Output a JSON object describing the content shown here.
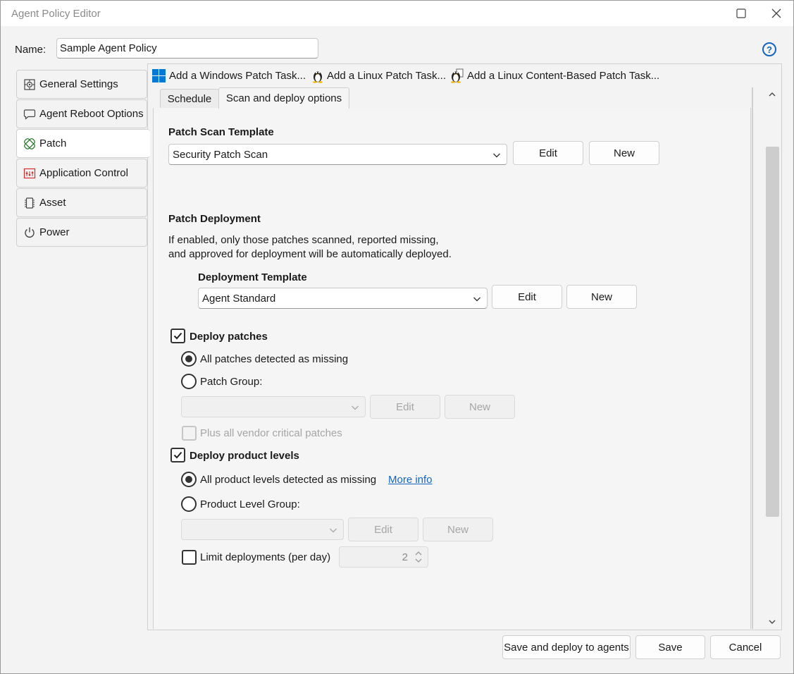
{
  "window": {
    "title": "Agent Policy Editor"
  },
  "name": {
    "label": "Name:",
    "value": "Sample Agent Policy"
  },
  "sidebar": {
    "items": [
      {
        "label": "General Settings",
        "icon": "gear-icon"
      },
      {
        "label": "Agent Reboot Options",
        "icon": "speech-bubble-icon"
      },
      {
        "label": "Patch",
        "icon": "patch-icon"
      },
      {
        "label": "Application Control",
        "icon": "application-control-icon"
      },
      {
        "label": "Asset",
        "icon": "chip-icon"
      },
      {
        "label": "Power",
        "icon": "power-icon"
      }
    ],
    "active_index": 2
  },
  "toolbar": {
    "windows_task": "Add a Windows Patch Task...",
    "linux_task": "Add a Linux Patch Task...",
    "linux_content_task": "Add a Linux Content-Based Patch Task..."
  },
  "tabs": [
    {
      "label": "Schedule"
    },
    {
      "label": "Scan and deploy options"
    }
  ],
  "scan": {
    "heading": "Patch Scan Template",
    "template_value": "Security Patch Scan",
    "edit_label": "Edit",
    "new_label": "New"
  },
  "deployment": {
    "heading": "Patch Deployment",
    "description_line1": "If enabled, only those patches scanned, reported missing,",
    "description_line2": "and approved for deployment will be automatically deployed.",
    "template_heading": "Deployment Template",
    "template_value": "Agent Standard",
    "edit_label": "Edit",
    "new_label": "New"
  },
  "deploy_patches": {
    "label": "Deploy patches",
    "checked": true,
    "option_all": "All patches detected as missing",
    "option_group": "Patch Group:",
    "selected": "all",
    "group_value": "",
    "edit_label": "Edit",
    "new_label": "New",
    "vendor_critical_label": "Plus all vendor critical patches",
    "vendor_critical_checked": false
  },
  "deploy_product_levels": {
    "label": "Deploy product levels",
    "checked": true,
    "option_all": "All product levels detected as missing",
    "more_info": "More info",
    "option_group": "Product Level Group:",
    "selected": "all",
    "group_value": "",
    "edit_label": "Edit",
    "new_label": "New"
  },
  "limit": {
    "label": "Limit deployments (per day)",
    "checked": false,
    "value": "2"
  },
  "footer": {
    "save_deploy": "Save and deploy to agents",
    "save": "Save",
    "cancel": "Cancel"
  },
  "colors": {
    "accent": "#1565c0",
    "windows_blue": "#0078d4",
    "app_control_red": "#d32f2f",
    "patch_green": "#2e7d32"
  }
}
